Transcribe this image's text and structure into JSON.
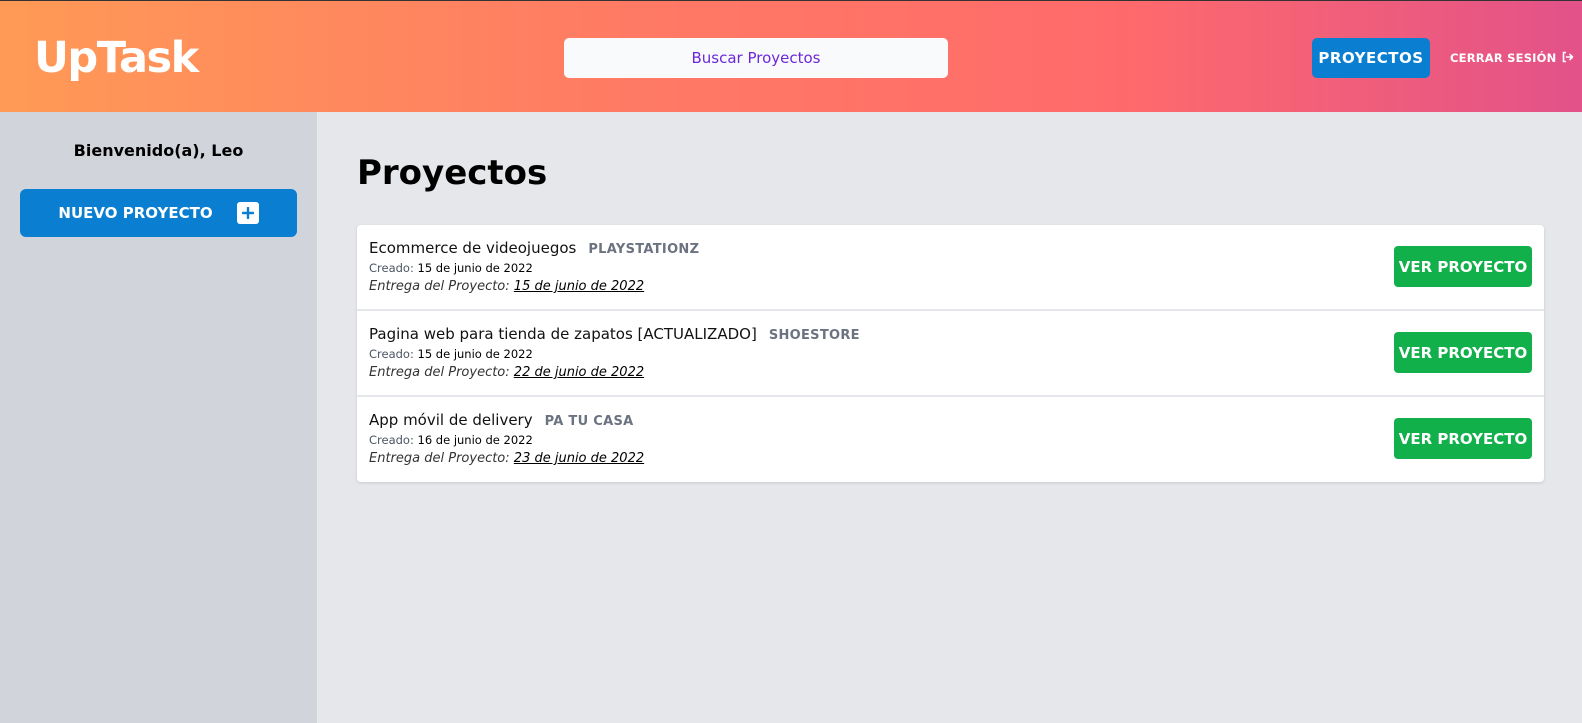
{
  "header": {
    "logo": "UpTask",
    "search_placeholder": "Buscar Proyectos",
    "projects_button": "PROYECTOS",
    "logout_label": "CERRAR SESIÓN"
  },
  "sidebar": {
    "welcome": "Bienvenido(a), Leo",
    "new_project_label": "NUEVO PROYECTO"
  },
  "main": {
    "title": "Proyectos",
    "created_label": "Creado:",
    "due_label": "Entrega del Proyecto:",
    "view_label": "VER PROYECTO",
    "projects": [
      {
        "name": "Ecommerce de videojuegos",
        "client": "PLAYSTATIONZ",
        "created": "15 de junio de 2022",
        "due": "15 de junio de 2022"
      },
      {
        "name": "Pagina web para tienda de zapatos [ACTUALIZADO]",
        "client": "SHOESTORE",
        "created": "15 de junio de 2022",
        "due": "22 de junio de 2022"
      },
      {
        "name": "App móvil de delivery",
        "client": "PA TU CASA",
        "created": "16 de junio de 2022",
        "due": "23 de junio de 2022"
      }
    ]
  },
  "icons": {
    "logout": "logout-icon",
    "plus": "plus-icon"
  },
  "colors": {
    "primary": "#0a7fd2",
    "success": "#12b04b",
    "accent_text": "#6d28d9",
    "sidebar_bg": "#d1d5db",
    "page_bg": "#e5e7eb"
  }
}
